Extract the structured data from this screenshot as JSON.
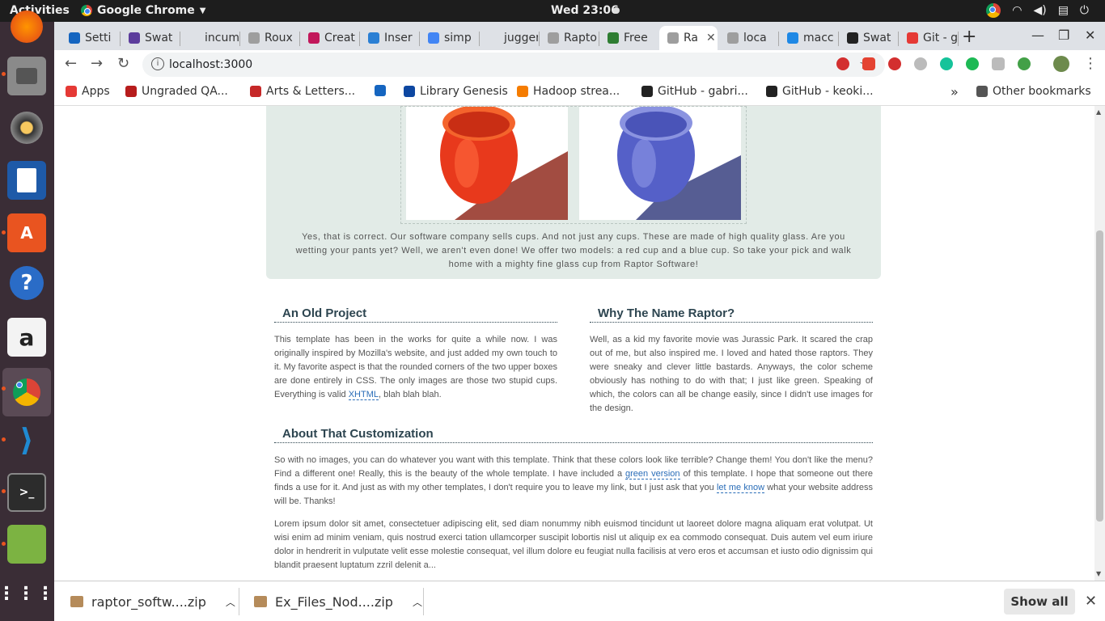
{
  "topbar": {
    "activities": "Activities",
    "app_name": "Google Chrome",
    "clock": "Wed 23:06"
  },
  "tabs": [
    {
      "label": "Setti",
      "color": "#1565c0"
    },
    {
      "label": "Swat",
      "color": "#5c3c9c"
    },
    {
      "label": "incumbe",
      "color": "#dee1e6"
    },
    {
      "label": "Roux",
      "color": "#9e9e9e"
    },
    {
      "label": "Creat",
      "color": "#c2185b"
    },
    {
      "label": "Inser",
      "color": "#2a7fd4"
    },
    {
      "label": "simp",
      "color": "#4285f4"
    },
    {
      "label": "juggerna",
      "color": "#dee1e6"
    },
    {
      "label": "Rapto",
      "color": "#9e9e9e"
    },
    {
      "label": "Free",
      "color": "#2e7d32"
    },
    {
      "label": "Ra",
      "color": "#9e9e9e",
      "active": true
    },
    {
      "label": "loca",
      "color": "#9e9e9e"
    },
    {
      "label": "macc",
      "color": "#1e88e5"
    },
    {
      "label": "Swat",
      "color": "#222222"
    },
    {
      "label": "Git - g",
      "color": "#e53935"
    }
  ],
  "toolbar": {
    "url": "localhost:3000"
  },
  "bookmarks": [
    {
      "label": "Apps",
      "color": "#e53935"
    },
    {
      "label": "Ungraded QA...",
      "color": "#b71c1c"
    },
    {
      "label": "Arts & Letters...",
      "color": "#c62828"
    },
    {
      "label": "",
      "color": "#1565c0"
    },
    {
      "label": "Library Genesis",
      "color": "#0d47a1"
    },
    {
      "label": "Hadoop strea...",
      "color": "#f57c00"
    },
    {
      "label": "GitHub - gabri...",
      "color": "#222222"
    },
    {
      "label": "GitHub - keoki...",
      "color": "#222222"
    }
  ],
  "bookmarks_other": "Other bookmarks",
  "page": {
    "banner_text": "Yes, that is correct. Our software company sells cups. And not just any cups. These are made of high quality glass. Are you wetting your pants yet? Well, we aren't even done! We offer two models: a red cup and a blue cup. So take your pick and walk home with a mighty fine glass cup from Raptor Software!",
    "old_project": {
      "title": "An Old Project",
      "text_before": "This template has been in the works for quite a while now. I was originally inspired by Mozilla's website, and just added my own touch to it. My favorite aspect is that the rounded corners of the two upper boxes are done entirely in CSS. The only images are those two stupid cups. Everything is valid ",
      "link": "XHTML",
      "text_after": ", blah blah blah."
    },
    "why_raptor": {
      "title": "Why The Name Raptor?",
      "text": "Well, as a kid my favorite movie was Jurassic Park. It scared the crap out of me, but also inspired me. I loved and hated those raptors. They were sneaky and clever little bastards. Anyways, the color scheme obviously has nothing to do with that; I just like green. Speaking of which, the colors can all be change easily, since I didn't use images for the design."
    },
    "customization": {
      "title": "About That Customization",
      "text_1": "So with no images, you can do whatever you want with this template. Think that these colors look like terrible? Change them! You don't like the menu? Find a different one! Really, this is the beauty of the whole template. I have included a ",
      "link_1": "green version",
      "text_2": " of this template. I hope that someone out there finds a use for it. And just as with my other templates, I don't require you to leave my link, but I just ask that you ",
      "link_2": "let me know",
      "text_3": " what your website address will be. Thanks!",
      "lorem": "Lorem ipsum dolor sit amet, consectetuer adipiscing elit, sed diam nonummy nibh euismod tincidunt ut laoreet dolore magna aliquam erat volutpat. Ut wisi enim ad minim veniam, quis nostrud exerci tation ullamcorper suscipit lobortis nisl ut aliquip ex ea commodo consequat. Duis autem vel eum iriure dolor in hendrerit in vulputate velit esse molestie consequat, vel illum dolore eu feugiat nulla facilisis at vero eros et accumsan et iusto odio dignissim qui blandit praesent luptatum zzril delenit a..."
    }
  },
  "downloads": {
    "items": [
      "raptor_softw....zip",
      "Ex_Files_Nod....zip"
    ],
    "show_all": "Show all"
  },
  "colors": {
    "banner_bg": "#e2ebe7",
    "heading": "#2d4550",
    "link": "#2a6db8",
    "cup_red": "#e8391c",
    "cup_blue": "#5560c8"
  }
}
